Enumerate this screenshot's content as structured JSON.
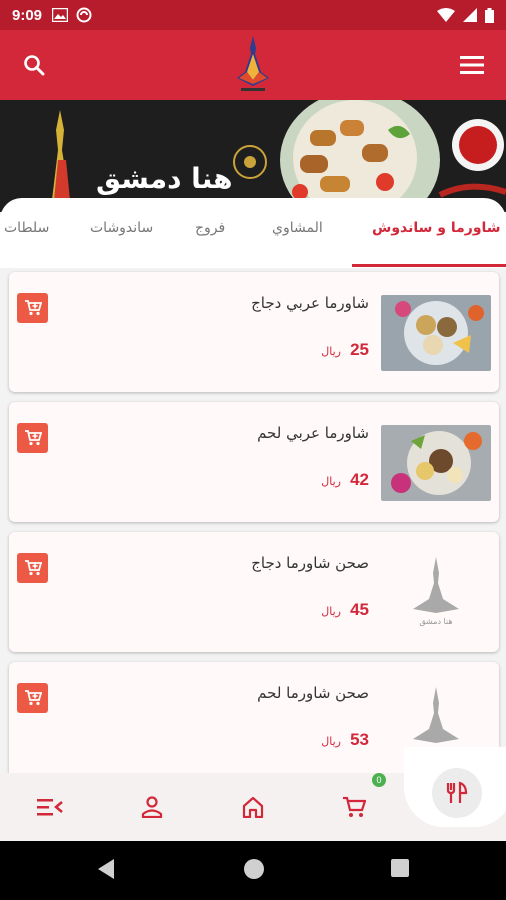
{
  "status_bar": {
    "time": "9:09"
  },
  "app_bar": {
    "search_icon": "search-icon",
    "menu_icon": "hamburger-menu-icon",
    "logo": "restaurant-logo"
  },
  "banner": {
    "brand_text": "هنا دمشق"
  },
  "tabs": [
    {
      "label": "شاورما و ساندوش",
      "active": true
    },
    {
      "label": "المشاوي",
      "active": false
    },
    {
      "label": "فروج",
      "active": false
    },
    {
      "label": "ساندوشات",
      "active": false
    },
    {
      "label": "سلطات",
      "active": false
    }
  ],
  "items": [
    {
      "name": "شاورما عربي دجاج",
      "price": "25",
      "currency": "ريال",
      "image": "photo"
    },
    {
      "name": "شاورما عربي لحم",
      "price": "42",
      "currency": "ريال",
      "image": "photo"
    },
    {
      "name": "صحن شاورما دجاج",
      "price": "45",
      "currency": "ريال",
      "image": "placeholder-logo",
      "placeholder_caption": "هنا دمشق"
    },
    {
      "name": "صحن شاورما لحم",
      "price": "53",
      "currency": "ريال",
      "image": "placeholder-logo",
      "placeholder_caption": "هنا دمشق"
    }
  ],
  "bottom_nav": {
    "items": [
      "list-menu-icon",
      "user-icon",
      "home-icon",
      "cart-icon",
      "restaurant-menu-icon"
    ],
    "cart_badge": "0"
  },
  "colors": {
    "primary": "#d2283a",
    "status_bar": "#b71c2c",
    "accent": "#ec5a46",
    "badge": "#4caf50"
  }
}
